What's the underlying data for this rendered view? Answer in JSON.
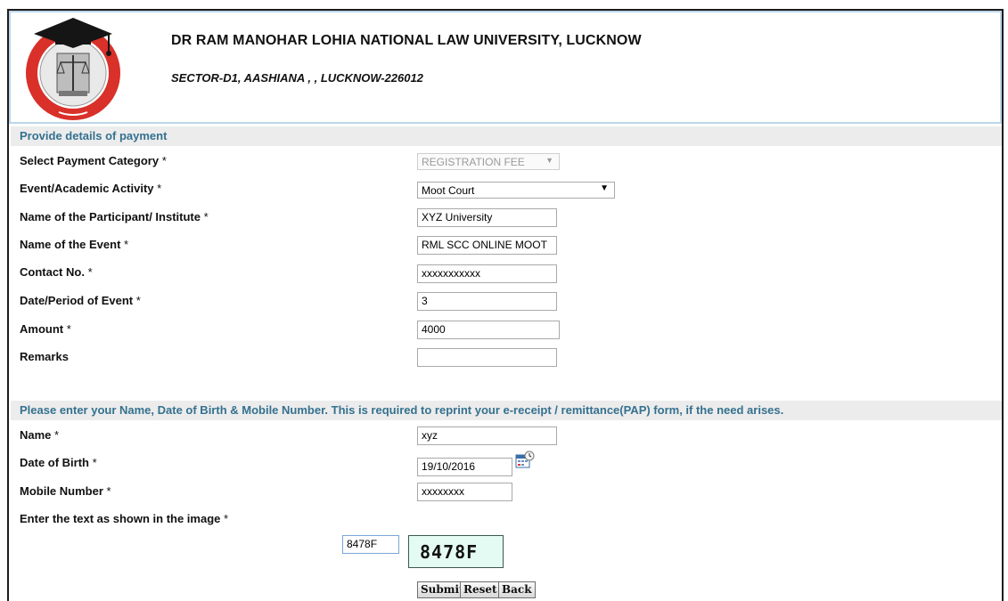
{
  "header": {
    "university_name": "DR RAM MANOHAR LOHIA NATIONAL LAW UNIVERSITY, LUCKNOW",
    "address": "SECTOR-D1, AASHIANA , , LUCKNOW-226012",
    "logo_icon": "university-seal-icon",
    "colors": {
      "logo_red": "#d9302a",
      "header_border": "#bcd6ea",
      "section_text": "#34718f"
    }
  },
  "payment_section": {
    "title": "Provide details of payment",
    "fields": {
      "category": {
        "label": "Select Payment Category",
        "value": "REGISTRATION FEE"
      },
      "event_activity": {
        "label": "Event/Academic Activity",
        "value": "Moot Court"
      },
      "participant": {
        "label": "Name of the Participant/ Institute",
        "value": "XYZ University"
      },
      "event_name": {
        "label": "Name of the Event",
        "value": "RML SCC ONLINE MOOT"
      },
      "contact": {
        "label": "Contact No.",
        "value": "xxxxxxxxxxx"
      },
      "date_period": {
        "label": "Date/Period of Event",
        "value": "3"
      },
      "amount": {
        "label": "Amount",
        "value": "4000"
      },
      "remarks": {
        "label": "Remarks",
        "value": ""
      }
    }
  },
  "personal_section": {
    "title": "Please enter your Name, Date of Birth & Mobile Number. This is required to reprint your e-receipt / remittance(PAP) form, if the need arises.",
    "fields": {
      "name": {
        "label": "Name",
        "value": "xyz"
      },
      "dob": {
        "label": "Date of Birth",
        "value": "19/10/2016"
      },
      "mobile": {
        "label": "Mobile Number",
        "value": "xxxxxxxx"
      },
      "captcha": {
        "label": "Enter the text as shown in the image",
        "value": "8478F",
        "image_text": "8478F"
      }
    }
  },
  "required_mark": "*",
  "buttons": {
    "submit": "Submit",
    "reset": "Reset",
    "back": "Back"
  }
}
